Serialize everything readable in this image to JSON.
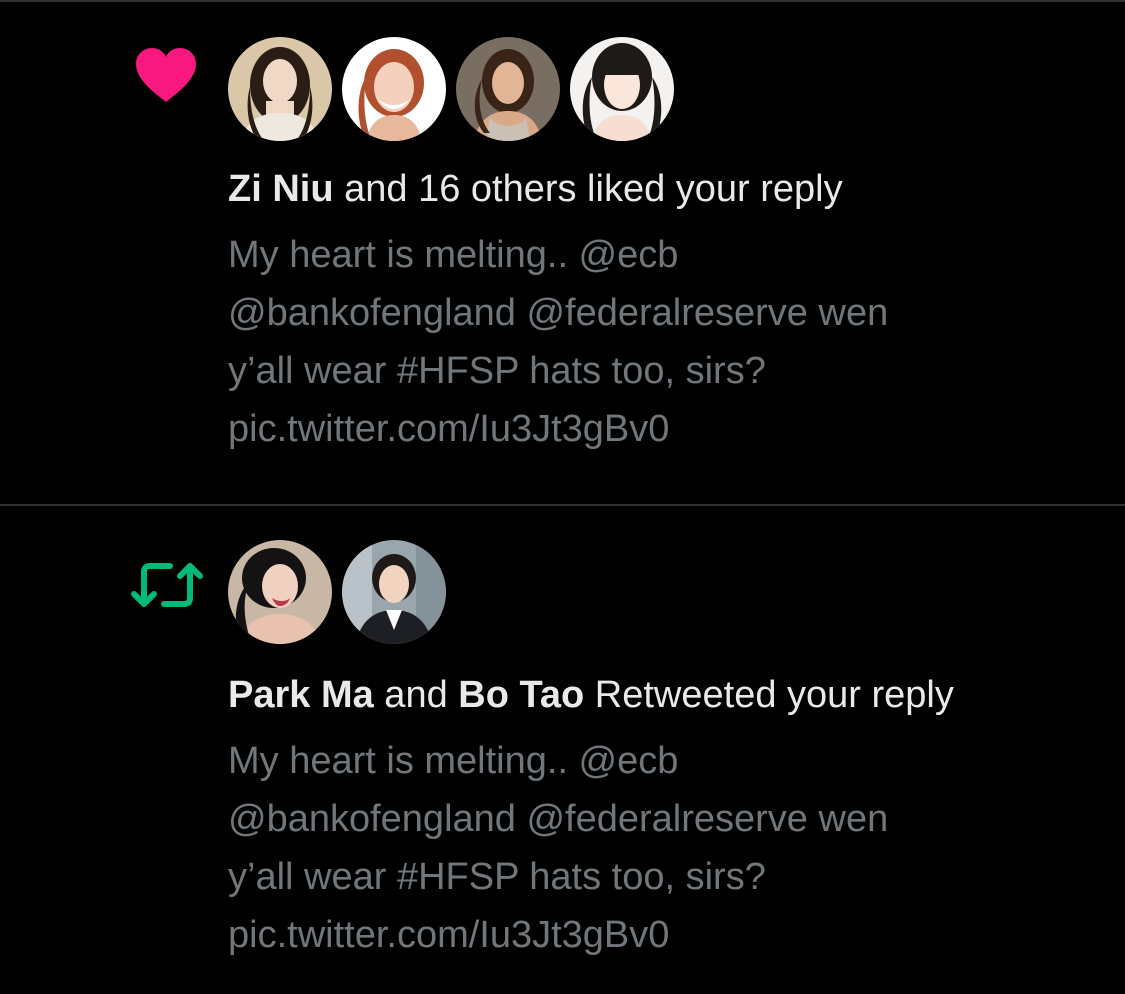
{
  "colors": {
    "background": "#000000",
    "primary_text": "#e7e9ea",
    "secondary_text": "#71767b",
    "divider": "#2f3336",
    "like_pink": "#f91880",
    "retweet_green": "#00ba7c"
  },
  "notifications": [
    {
      "type": "like",
      "icon": "heart-icon",
      "avatars": [
        {
          "name": "avatar-1"
        },
        {
          "name": "avatar-2"
        },
        {
          "name": "avatar-3"
        },
        {
          "name": "avatar-4"
        }
      ],
      "headline": {
        "user1": "Zi Niu",
        "rest": " and 16 others liked your reply"
      },
      "text_lines": [
        "My heart is melting.. @ecb",
        "@bankofengland @federalreserve wen",
        "y’all wear #HFSP hats too, sirs?",
        "pic.twitter.com/Iu3Jt3gBv0"
      ]
    },
    {
      "type": "retweet",
      "icon": "retweet-icon",
      "avatars": [
        {
          "name": "avatar-1"
        },
        {
          "name": "avatar-2"
        }
      ],
      "headline": {
        "user1": "Park Ma",
        "conj": " and ",
        "user2": "Bo Tao",
        "rest": " Retweeted your reply"
      },
      "text_lines": [
        "My heart is melting.. @ecb",
        "@bankofengland @federalreserve wen",
        "y’all wear #HFSP hats too, sirs?",
        "pic.twitter.com/Iu3Jt3gBv0"
      ]
    }
  ]
}
